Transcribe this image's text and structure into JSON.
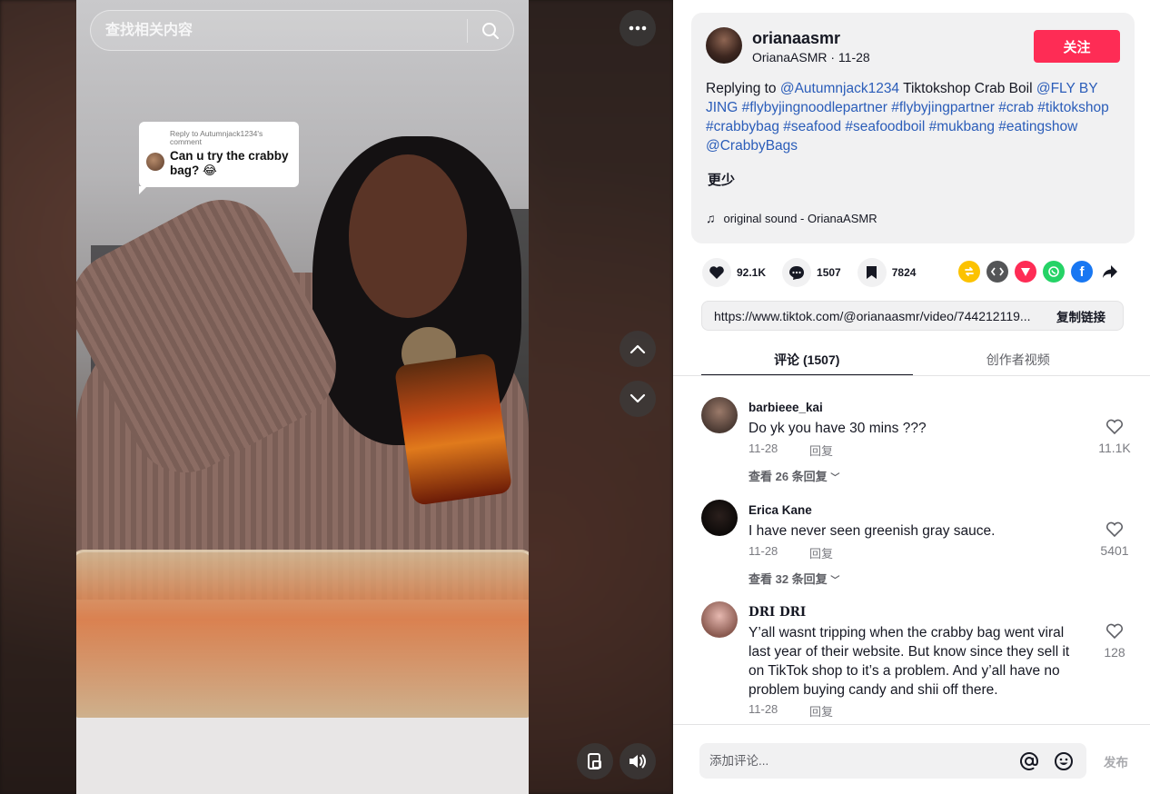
{
  "video": {
    "search_placeholder": "查找相关内容",
    "reply_bubble": {
      "reply_to": "Reply to Autumnjack1234's comment",
      "question": "Can u try the crabby bag? 😂"
    }
  },
  "author": {
    "username": "orianaasmr",
    "meta": "OrianaASMR · 11-28",
    "follow_label": "关注",
    "description": {
      "prefix": "Replying to ",
      "mention_reply": "@Autumnjack1234",
      "text": " Tiktokshop Crab Boil ",
      "tags": "@FLY BY JING #flybyjingnoodlepartner #flybyjingpartner #crab #tiktokshop #crabbybag #seafood #seafoodboil #mukbang #eatingshow @CrabbyBags"
    },
    "more_label": "更少",
    "music": "original sound - OrianaASMR"
  },
  "actions": {
    "likes": "92.1K",
    "comments": "1507",
    "saves": "7824"
  },
  "share_icons": [
    "repost-icon",
    "embed-icon",
    "send-icon",
    "whatsapp-icon",
    "facebook-icon",
    "share-arrow-icon"
  ],
  "link": {
    "url": "https://www.tiktok.com/@orianaasmr/video/744212119...",
    "copy_label": "复制链接"
  },
  "tabs": {
    "comments": "评论 (1507)",
    "creator_videos": "创作者视频"
  },
  "comments": [
    {
      "user": "barbieee_kai",
      "text": "Do yk you have 30 mins ???",
      "date": "11-28",
      "reply_label": "回复",
      "likes": "11.1K",
      "replies_label": "查看 26 条回复"
    },
    {
      "user": "Erica Kane",
      "text": "I have never seen greenish gray sauce.",
      "date": "11-28",
      "reply_label": "回复",
      "likes": "5401",
      "replies_label": "查看 32 条回复"
    },
    {
      "user": "𝐃𝐑𝐈 𝐃𝐑𝐈",
      "text": "Y’all wasnt tripping when the crabby bag went viral last year of their website. But know since they sell it on TikTok shop to it’s a problem. And y’all have no problem buying candy and shii off there.",
      "date": "11-28",
      "reply_label": "回复",
      "likes": "128"
    }
  ],
  "composer": {
    "placeholder": "添加评论...",
    "post_label": "发布"
  },
  "colors": {
    "follow": "#fe2c55",
    "hashtag": "#2b5db9",
    "panel_gray": "#f1f1f2"
  }
}
